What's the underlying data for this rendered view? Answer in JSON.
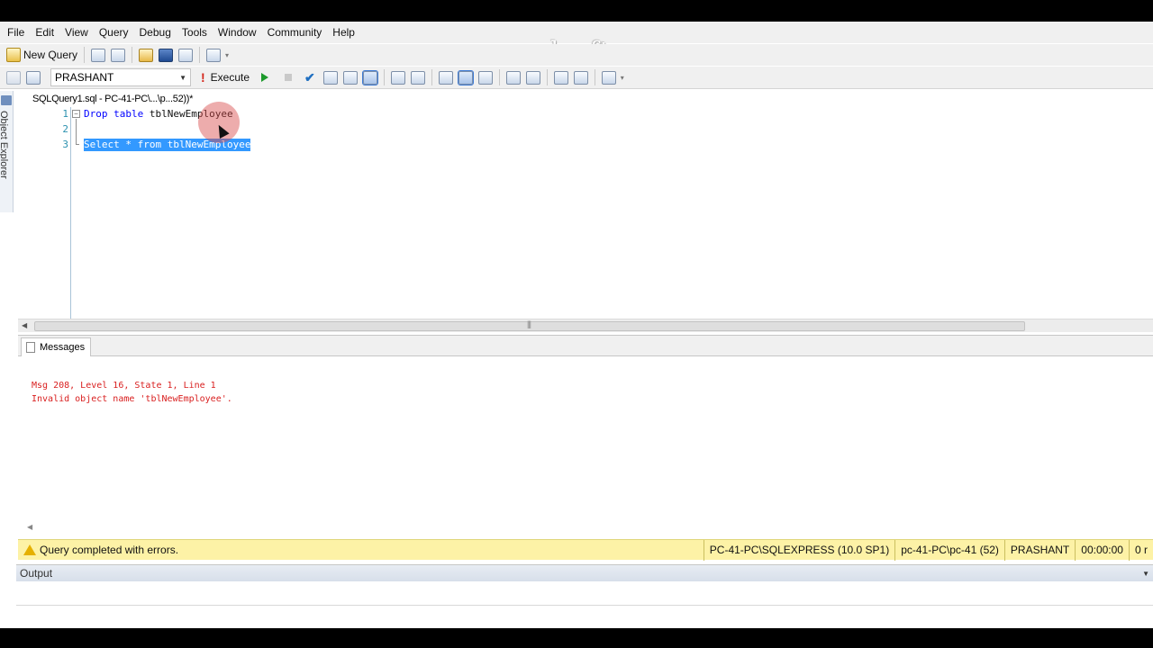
{
  "menu": [
    "File",
    "Edit",
    "View",
    "Query",
    "Debug",
    "Tools",
    "Window",
    "Community",
    "Help"
  ],
  "watermark": "www.zdsoft.com",
  "toolbar1": {
    "new_query_label": "New Query"
  },
  "toolbar2": {
    "server": "PRASHANT",
    "execute_label": "Execute"
  },
  "object_explorer": {
    "label": "Object Explorer"
  },
  "doc_tab": {
    "title": "SQLQuery1.sql - PC-41-PC\\...\\p...52))*"
  },
  "editor": {
    "line_numbers": [
      "1",
      "2",
      "3"
    ],
    "line1": {
      "kw1": "Drop",
      "kw2": "table",
      "ident": "tblNewEmployee"
    },
    "line3": {
      "kw1": "Select",
      "star": "*",
      "kw2": "from",
      "ident": "tblNewEmployee"
    }
  },
  "results": {
    "tab_label": "Messages",
    "messages": [
      "Msg 208, Level 16, State 1, Line 1",
      "Invalid object name 'tblNewEmployee'."
    ]
  },
  "status": {
    "text": "Query completed with errors.",
    "server": "PC-41-PC\\SQLEXPRESS (10.0 SP1)",
    "login": "pc-41-PC\\pc-41 (52)",
    "database": "PRASHANT",
    "elapsed": "00:00:00",
    "rows": "0 r"
  },
  "output": {
    "label": "Output"
  },
  "colors": {
    "status_bg": "#fdf2a6",
    "error_text": "#d92020",
    "selection": "#3399ff",
    "keyword": "#0000ff"
  }
}
